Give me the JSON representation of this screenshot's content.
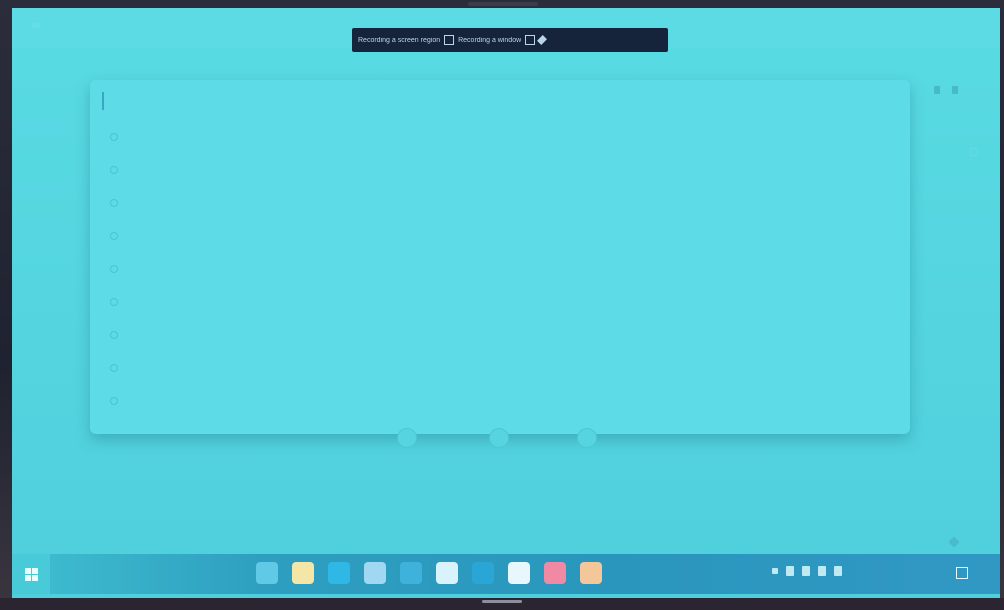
{
  "capture_bar": {
    "left_text": "Recording a screen region",
    "right_text": "Recording a window",
    "icons": [
      "window-icon",
      "pen-icon"
    ]
  },
  "search": {
    "placeholder": "",
    "suggestions": [
      {
        "prefix": "",
        "bold": "",
        "meta": "",
        "icon": "search-icon"
      },
      {
        "prefix": "",
        "bold": "",
        "meta": "",
        "icon": "search-icon"
      },
      {
        "prefix": "",
        "bold": "",
        "meta": "",
        "icon": "search-icon"
      },
      {
        "prefix": "",
        "bold": "",
        "meta": "",
        "icon": "search-icon"
      },
      {
        "prefix": "",
        "bold": "",
        "meta": "",
        "icon": "search-icon"
      },
      {
        "prefix": "",
        "bold": "",
        "meta": "",
        "icon": "search-icon"
      },
      {
        "prefix": "",
        "bold": "",
        "meta": "",
        "icon": "search-icon"
      },
      {
        "prefix": "",
        "bold": "",
        "meta": "",
        "icon": "search-icon"
      },
      {
        "prefix": "",
        "bold": "",
        "meta": "",
        "icon": "globe-icon"
      }
    ]
  },
  "shortcuts": [
    {
      "label": "",
      "icon": "shortcut-icon"
    },
    {
      "label": "",
      "icon": "shortcut-icon"
    },
    {
      "label": "",
      "icon": "add-shortcut-icon"
    }
  ],
  "customize": {
    "label": ""
  },
  "taskbar": {
    "apps": [
      {
        "name": "task-view-icon",
        "color": "#5fc9e6"
      },
      {
        "name": "file-explorer-icon",
        "color": "#f3e6a6"
      },
      {
        "name": "edge-icon",
        "color": "#2fb7e6"
      },
      {
        "name": "store-icon",
        "color": "#9fd8f0"
      },
      {
        "name": "settings-icon",
        "color": "#3fb2dc"
      },
      {
        "name": "mail-icon",
        "color": "#d8f3fb"
      },
      {
        "name": "app-icon",
        "color": "#2aa6d6"
      },
      {
        "name": "app-icon",
        "color": "#e7f7fb"
      },
      {
        "name": "app-icon",
        "color": "#f08aa4"
      },
      {
        "name": "chrome-icon",
        "color": "#f4c79a"
      }
    ],
    "clock_time": "",
    "clock_date": ""
  },
  "colors": {
    "screen": "#55d6e0",
    "panel": "#5ddbe6",
    "taskbar": "#2a96bd",
    "accent": "#2c95b3"
  }
}
